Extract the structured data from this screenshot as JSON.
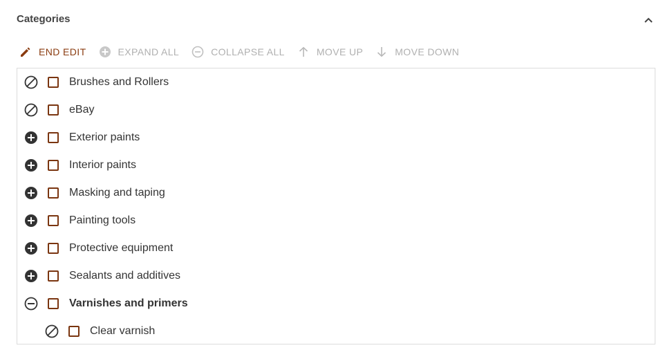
{
  "panel": {
    "title": "Categories"
  },
  "toolbar": {
    "end_edit": "END EDIT",
    "expand_all": "EXPAND ALL",
    "collapse_all": "COLLAPSE ALL",
    "move_up": "MOVE UP",
    "move_down": "MOVE DOWN"
  },
  "tree": {
    "items": [
      {
        "label": "Brushes and Rollers",
        "state": "none"
      },
      {
        "label": "eBay",
        "state": "none"
      },
      {
        "label": "Exterior paints",
        "state": "expand"
      },
      {
        "label": "Interior paints",
        "state": "expand"
      },
      {
        "label": "Masking and taping",
        "state": "expand"
      },
      {
        "label": "Painting tools",
        "state": "expand"
      },
      {
        "label": "Protective equipment",
        "state": "expand"
      },
      {
        "label": "Sealants and additives",
        "state": "expand"
      },
      {
        "label": "Varnishes and primers",
        "state": "collapse"
      },
      {
        "label": "Clear varnish",
        "state": "none",
        "level": 1
      }
    ]
  },
  "colors": {
    "accent": "#8a3c10",
    "checkbox_border": "#7a3510",
    "disabled": "#b0b0b0",
    "icon_dark": "#333333",
    "border": "#dcdcdc"
  }
}
